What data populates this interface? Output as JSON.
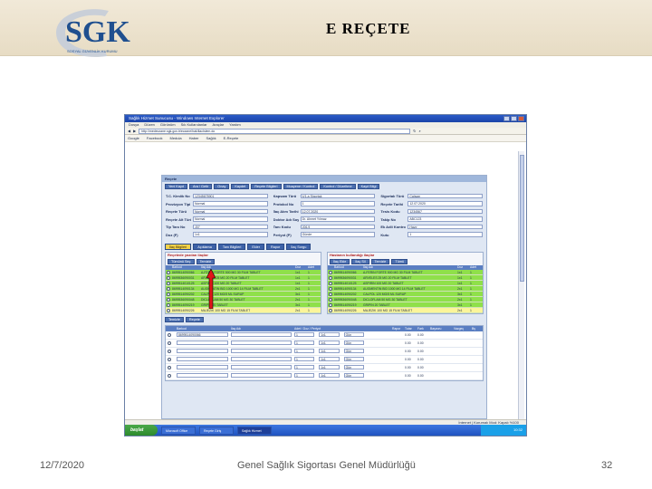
{
  "slide": {
    "title": "E REÇETE",
    "date": "12/7/2020",
    "organization": "Genel Sağlık Sigortası Genel Müdürlüğü",
    "page_number": "32"
  },
  "logo": {
    "text": "SGK",
    "subtitle": "SOSYAL GÜVENLİK KURUMU",
    "color": "#1f4f8f"
  },
  "browser": {
    "title": "Sağlık Hizmet Sunucusu - Windows Internet Explorer",
    "menu": [
      "Dosya",
      "Düzen",
      "Görünüm",
      "Sık Kullanılanlar",
      "Araçlar",
      "Yardım"
    ],
    "address": "http://medeczane.sgk.gov.tr/eczane/hak/ilacIslem.do",
    "favorites": [
      "Google",
      "Facebook",
      "Medula",
      "Haber",
      "Sağlık",
      "E-Reçete"
    ],
    "statusbar": "İnternet | Korumalı Mod: Kapalı  %100"
  },
  "taskbar": {
    "start_label": "başlat",
    "tasks": [
      "Microsoft Office",
      "Reçete Giriş",
      "Sağlık Hizmet"
    ],
    "clock": "10:32"
  },
  "app": {
    "panel_title": "Reçete",
    "top_buttons": [
      "Yeni Kayıt",
      "Ara / Getir",
      "Onay",
      "Kaydet",
      "Reçete Bilgileri",
      "Muayene / Kontrol",
      "Kontrol / Düzeltme",
      "Kayıt Bilgi"
    ],
    "form_rows": [
      [
        {
          "label": "T.C. Kimlik No",
          "value": "12345678901"
        },
        {
          "label": "Kapsam Türü",
          "value": "4/1-a Sigortalı"
        },
        {
          "label": "Sigortalı Türü",
          "value": "Çalışan"
        }
      ],
      [
        {
          "label": "Provizyon Tipi",
          "value": "Normal"
        },
        {
          "label": "Protokol No",
          "value": "1"
        },
        {
          "label": "Reçete Tarihi",
          "value": "12.07.2020"
        }
      ],
      [
        {
          "label": "Reçete Türü",
          "value": "Normal"
        },
        {
          "label": "İlaç Alım Tarihi",
          "value": "12.07.2020"
        },
        {
          "label": "Tesis Kodu",
          "value": "1234567"
        }
      ],
      [
        {
          "label": "Reçete Alt Türü",
          "value": "Normal"
        },
        {
          "label": "Doktor Adı Soyadı",
          "value": "Dr. Ahmet Yılmaz"
        },
        {
          "label": "Takip No",
          "value": "ABC123"
        }
      ],
      [
        {
          "label": "Tip Tanı No",
          "value": "J07"
        },
        {
          "label": "Tanı Kodu",
          "value": "J06.9"
        },
        {
          "label": "Ek Adli Kontrol",
          "value": "Hayır"
        }
      ],
      [
        {
          "label": "Doz (F)",
          "value": "1x1"
        },
        {
          "label": "Periyot (P)",
          "value": "Günde"
        },
        {
          "label": "Kutu",
          "value": "1"
        }
      ]
    ],
    "tabs": [
      "İlaç Bilgileri",
      "Açıklama",
      "Tanı Bilgileri",
      "Ekler",
      "Rapor",
      "İlaç Sorgu"
    ],
    "left_list": {
      "title": "Reçetede yazılan ilaçlar",
      "sub_buttons": [
        "Tümünü Seç",
        "Temizle"
      ],
      "headers": [
        "",
        "Barkod",
        "İlaç Adı",
        "Doz",
        "Adet"
      ],
      "rows": [
        {
          "barkod": "8699514090066",
          "name": "A-FERIN FORTE 500 MG 30 FILM TABLET",
          "doz": "1x1",
          "adet": "1",
          "color": "g"
        },
        {
          "barkod": "8699536090031",
          "name": "ARVELES 25 MG 20 FILM TABLET",
          "doz": "1x1",
          "adet": "1",
          "color": "g"
        },
        {
          "barkod": "8699514010125",
          "name": "ASPIRIN 100 MG 20 TABLET",
          "doz": "1x1",
          "adet": "1",
          "color": "g"
        },
        {
          "barkod": "8699514090134",
          "name": "AUGMENTIN BID 1000 MG 14 FILM TABLET",
          "doz": "2x1",
          "adet": "1",
          "color": "g"
        },
        {
          "barkod": "8699514090202",
          "name": "CALPOL 120 MG/5 ML SURUP",
          "doz": "3x1",
          "adet": "1",
          "color": "g"
        },
        {
          "barkod": "8699536090048",
          "name": "DICLOFLAM 50 MG 30 TABLET",
          "doz": "2x1",
          "adet": "1",
          "color": "g"
        },
        {
          "barkod": "8699514090219",
          "name": "GRIPIN 20 TABLET",
          "doz": "3x1",
          "adet": "1",
          "color": "g"
        },
        {
          "barkod": "8699514090226",
          "name": "MAJEZIK 100 MG 15 FILM TABLET",
          "doz": "2x1",
          "adet": "1",
          "color": "y"
        }
      ]
    },
    "right_list": {
      "title": "Hastanın kullandığı ilaçlar",
      "sub_buttons": [
        "İlaç Ekle",
        "İlaç Sil",
        "Temizle",
        "Tümü"
      ],
      "headers": [
        "",
        "Barkod",
        "İlaç Adı",
        "Doz",
        "Adet"
      ],
      "rows": [
        {
          "barkod": "8699514090066",
          "name": "A-FERIN FORTE 500 MG 30 FILM TABLET",
          "doz": "1x1",
          "adet": "1",
          "color": "g"
        },
        {
          "barkod": "8699536090031",
          "name": "ARVELES 25 MG 20 FILM TABLET",
          "doz": "1x1",
          "adet": "1",
          "color": "g"
        },
        {
          "barkod": "8699514010125",
          "name": "ASPIRIN 100 MG 20 TABLET",
          "doz": "1x1",
          "adet": "1",
          "color": "g"
        },
        {
          "barkod": "8699514090134",
          "name": "AUGMENTIN BID 1000 MG 14 FILM TABLET",
          "doz": "2x1",
          "adet": "1",
          "color": "g"
        },
        {
          "barkod": "8699514090202",
          "name": "CALPOL 120 MG/5 ML SURUP",
          "doz": "3x1",
          "adet": "1",
          "color": "g"
        },
        {
          "barkod": "8699536090048",
          "name": "DICLOFLAM 50 MG 30 TABLET",
          "doz": "2x1",
          "adet": "1",
          "color": "g"
        },
        {
          "barkod": "8699514090219",
          "name": "GRIPIN 20 TABLET",
          "doz": "3x1",
          "adet": "1",
          "color": "g"
        },
        {
          "barkod": "8699514090226",
          "name": "MAJEZIK 100 MG 15 FILM TABLET",
          "doz": "2x1",
          "adet": "1",
          "color": "y"
        }
      ]
    },
    "below_buttons": [
      "Temizle",
      "Reçete"
    ],
    "grid2": {
      "headers": [
        "",
        "Barkod",
        "İlaç Adı",
        "Adet / Doz / Periyot",
        "",
        "Rapor",
        "Tutar",
        "Fark",
        "Başvuru",
        "Vazgeç",
        "Bş"
      ],
      "rows": [
        {
          "barkod": "8699514090066",
          "adet": "1",
          "doz": "1x1",
          "periyot": "Gün",
          "tutar": "0.00",
          "fark": "0.00"
        },
        {
          "barkod": "",
          "adet": "1",
          "doz": "1x1",
          "periyot": "Gün",
          "tutar": "0.00",
          "fark": "0.00"
        },
        {
          "barkod": "",
          "adet": "1",
          "doz": "1x1",
          "periyot": "Gün",
          "tutar": "0.00",
          "fark": "0.00"
        },
        {
          "barkod": "",
          "adet": "1",
          "doz": "1x1",
          "periyot": "Gün",
          "tutar": "0.00",
          "fark": "0.00"
        },
        {
          "barkod": "",
          "adet": "1",
          "doz": "1x1",
          "periyot": "Gün",
          "tutar": "0.00",
          "fark": "0.00"
        },
        {
          "barkod": "",
          "adet": "1",
          "doz": "1x1",
          "periyot": "Gün",
          "tutar": "0.00",
          "fark": "0.00"
        }
      ]
    }
  },
  "annotation": {
    "arrow_color": "#e01818"
  }
}
